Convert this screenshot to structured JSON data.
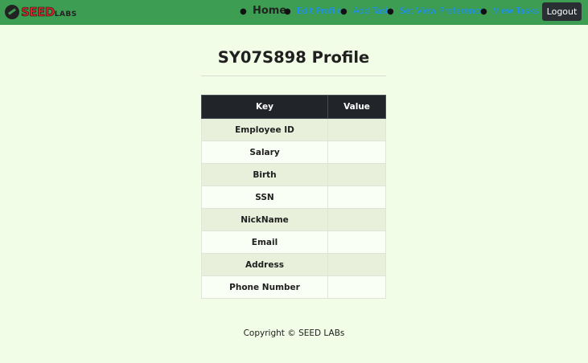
{
  "brand": {
    "name_main": "SEED",
    "name_small": "LABS"
  },
  "nav": {
    "home": "Home",
    "links": [
      "Edit Profile",
      "Add Task",
      "Set View Preference",
      "View Tasks"
    ],
    "logout": "Logout"
  },
  "page": {
    "title": "SY07S898 Profile"
  },
  "table": {
    "headers": {
      "key": "Key",
      "value": "Value"
    },
    "rows": [
      {
        "key": "Employee ID",
        "value": ""
      },
      {
        "key": "Salary",
        "value": ""
      },
      {
        "key": "Birth",
        "value": ""
      },
      {
        "key": "SSN",
        "value": ""
      },
      {
        "key": "NickName",
        "value": ""
      },
      {
        "key": "Email",
        "value": ""
      },
      {
        "key": "Address",
        "value": ""
      },
      {
        "key": "Phone Number",
        "value": ""
      }
    ]
  },
  "footer": {
    "text": "Copyright © SEED LABs"
  },
  "colors": {
    "navbar": "#3d9d53",
    "background": "#f1fde6",
    "link": "#1a8cff",
    "table_header": "#212529"
  }
}
